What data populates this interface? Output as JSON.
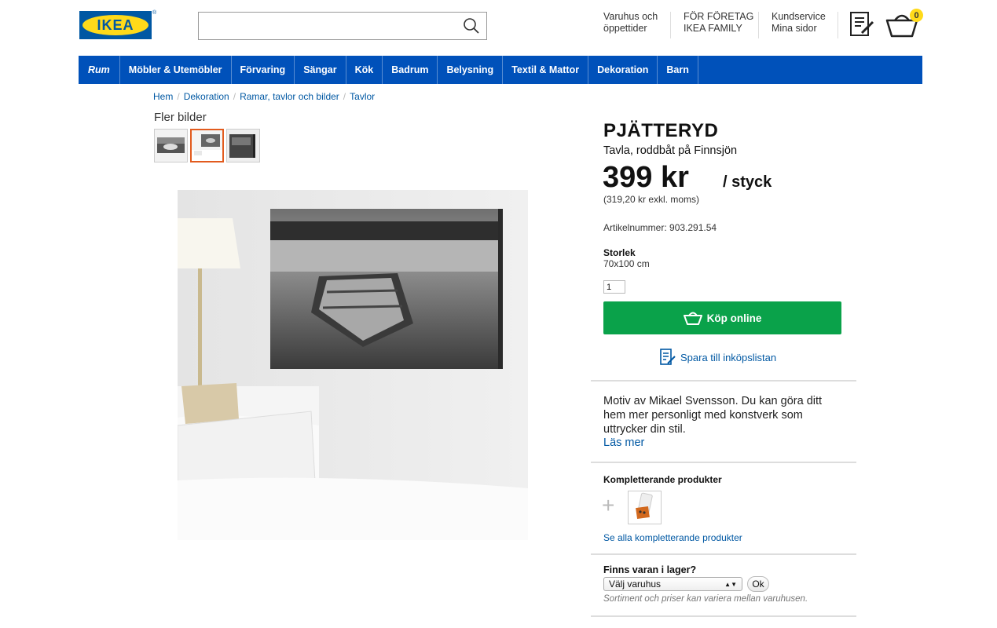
{
  "header": {
    "logo_text": "IKEA",
    "logo_reg": "®",
    "search_placeholder": "",
    "links": [
      {
        "line1": "Varuhus och",
        "line2": "öppettider"
      },
      {
        "line1": "FÖR FÖRETAG",
        "line2": "IKEA FAMILY"
      },
      {
        "line1": "Kundservice",
        "line2": "Mina sidor"
      }
    ],
    "cart_count": "0"
  },
  "nav": {
    "items": [
      "Rum",
      "Möbler & Utemöbler",
      "Förvaring",
      "Sängar",
      "Kök",
      "Badrum",
      "Belysning",
      "Textil & Mattor",
      "Dekoration",
      "Barn"
    ]
  },
  "breadcrumb": [
    "Hem",
    "Dekoration",
    "Ramar, tavlor och bilder",
    "Tavlor"
  ],
  "gallery": {
    "more_images_label": "Fler bilder"
  },
  "product": {
    "name": "PJÄTTERYD",
    "description": "Tavla, roddbåt på Finnsjön",
    "price": "399 kr",
    "unit": "/ styck",
    "price_excl": "(319,20 kr exkl. moms)",
    "article": "Artikelnummer: 903.291.54",
    "size_label": "Storlek",
    "size_value": "70x100 cm",
    "quantity": "1",
    "buy_label": "Köp online",
    "save_label": "Spara till inköpslistan",
    "motiv_text": "Motiv av Mikael Svensson. Du kan göra ditt hem mer personligt med konstverk som uttrycker din stil.",
    "read_more": "Läs mer"
  },
  "complementary": {
    "title": "Kompletterande produkter",
    "see_all": "Se alla kompletterande produkter"
  },
  "stock": {
    "title": "Finns varan i lager?",
    "select_value": "Välj varuhus",
    "ok_label": "Ok",
    "note": "Sortiment och priser kan variera mellan varuhusen."
  },
  "colors": {
    "nav_blue": "#0051ba",
    "buy_green": "#0aa24a",
    "link_blue": "#0058a3",
    "logo_yellow": "#ffda1a"
  }
}
